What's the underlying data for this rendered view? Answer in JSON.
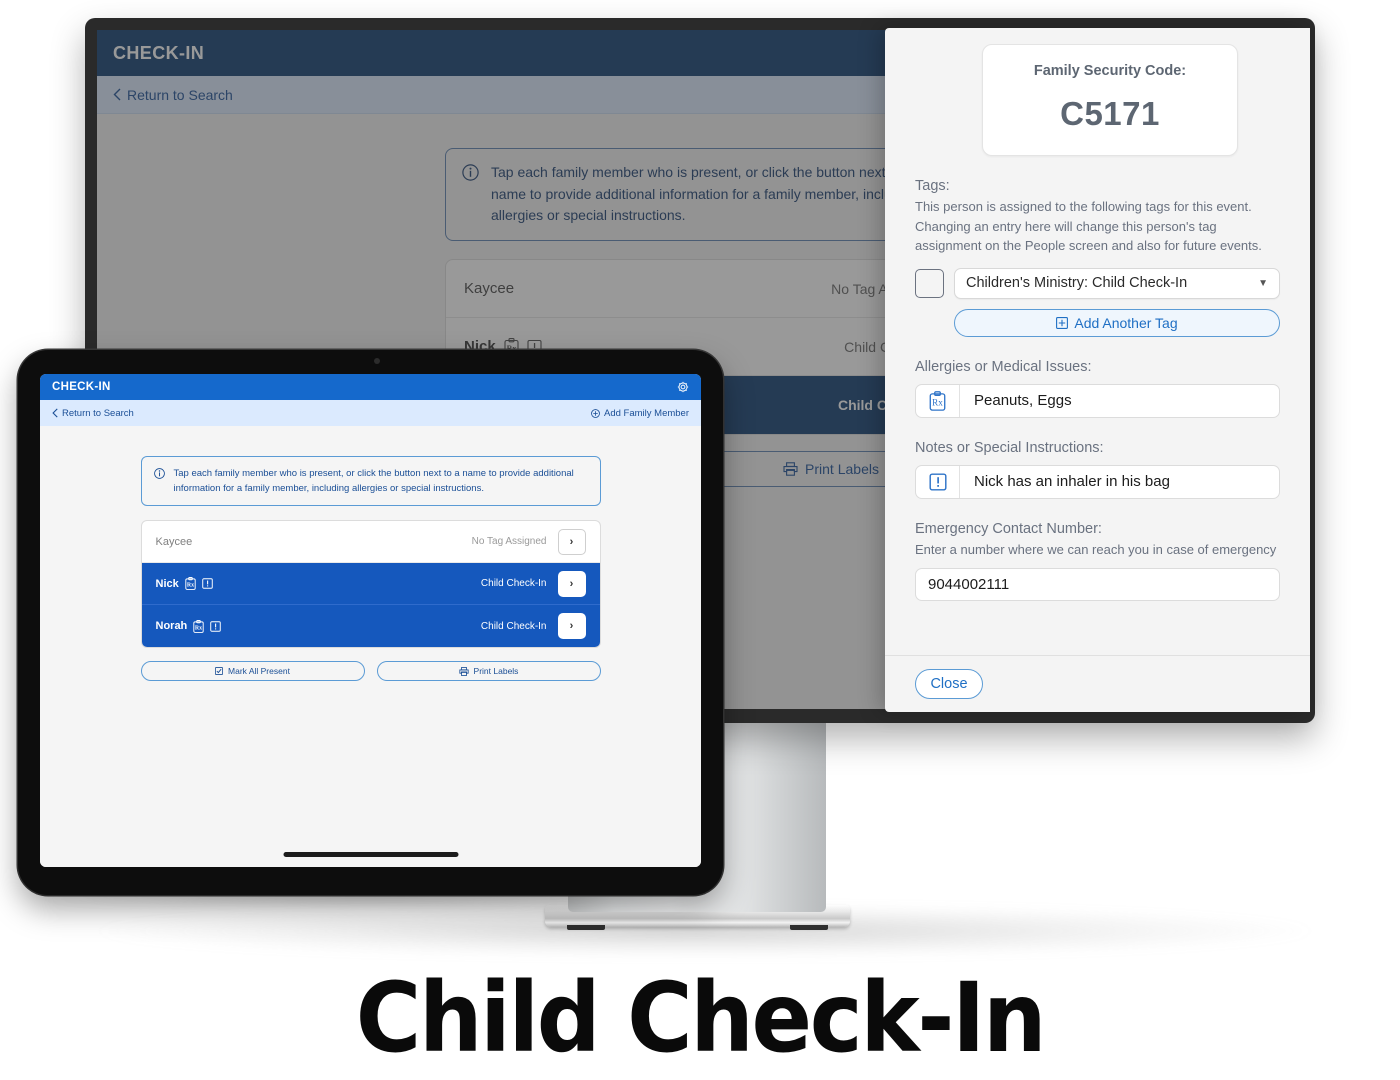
{
  "headline": "Child Check-In",
  "desktop": {
    "topbar": {
      "title": "CHECK-IN"
    },
    "subbar": {
      "return_label": "Return to Search",
      "back_chevron": "chevron-left-icon"
    },
    "callout": {
      "icon": "info-icon",
      "text": "Tap each family member who is present, or click the button next to a name to provide additional information for a family member, including allergies or special instructions."
    },
    "rows": [
      {
        "name": "Kaycee",
        "tag": "No Tag Assigned",
        "selected": false,
        "badges": []
      },
      {
        "name": "Nick",
        "tag": "Child Check-In",
        "selected": false,
        "badges": [
          "rx-icon",
          "alert-icon"
        ]
      },
      {
        "name": "Norah",
        "tag": "Child Check-In",
        "selected": true,
        "badges": [
          "rx-icon",
          "alert-icon"
        ]
      }
    ],
    "actions": [
      {
        "label": "Mark All Present",
        "icon": "checkbox-icon"
      },
      {
        "label": "Print Labels",
        "icon": "printer-icon"
      }
    ]
  },
  "modal": {
    "security": {
      "label": "Family Security Code:",
      "code": "C5171"
    },
    "tags": {
      "label": "Tags:",
      "description": "This person is assigned to the following tags for this event. Changing an entry here will change this person's tag assignment on the People screen and also for future events.",
      "selected_tag": "Children's Ministry: Child Check-In",
      "checkbox_checked": false,
      "add_tag_label": "Add Another Tag",
      "add_tag_icon": "plus-box-icon"
    },
    "allergies": {
      "label": "Allergies or Medical Issues:",
      "value": "Peanuts, Eggs",
      "icon": "rx-icon"
    },
    "notes": {
      "label": "Notes or Special Instructions:",
      "value": "Nick has an inhaler in his bag",
      "icon": "alert-icon"
    },
    "emergency": {
      "label": "Emergency Contact Number:",
      "description": "Enter a number where we can reach you in case of emergency",
      "value": "9044002111"
    },
    "footer": {
      "close_label": "Close"
    }
  },
  "tablet": {
    "topbar": {
      "title": "CHECK-IN",
      "gear_icon": "gear-icon"
    },
    "subbar": {
      "return_label": "Return to Search",
      "add_member_label": "Add Family Member",
      "back_chevron": "chevron-left-icon",
      "add_icon": "plus-circle-icon"
    },
    "callout": {
      "icon": "info-icon",
      "text": "Tap each family member who is present, or click the button next to a name to provide additional information for a family member, including allergies or special instructions."
    },
    "rows": [
      {
        "name": "Kaycee",
        "tag": "No Tag Assigned",
        "selected": false,
        "badges": []
      },
      {
        "name": "Nick",
        "tag": "Child Check-In",
        "selected": true,
        "badges": [
          "rx-icon",
          "alert-icon"
        ]
      },
      {
        "name": "Norah",
        "tag": "Child Check-In",
        "selected": true,
        "badges": [
          "rx-icon",
          "alert-icon"
        ]
      }
    ],
    "actions": [
      {
        "label": "Mark All Present",
        "icon": "checkbox-icon"
      },
      {
        "label": "Print Labels",
        "icon": "printer-icon"
      }
    ]
  },
  "colors": {
    "desktop_header": "#0e3b6f",
    "tablet_header": "#1569cc",
    "selected_row": "#1558bd",
    "link_blue": "#1b4f96",
    "accent_blue": "#1f6fc4"
  }
}
